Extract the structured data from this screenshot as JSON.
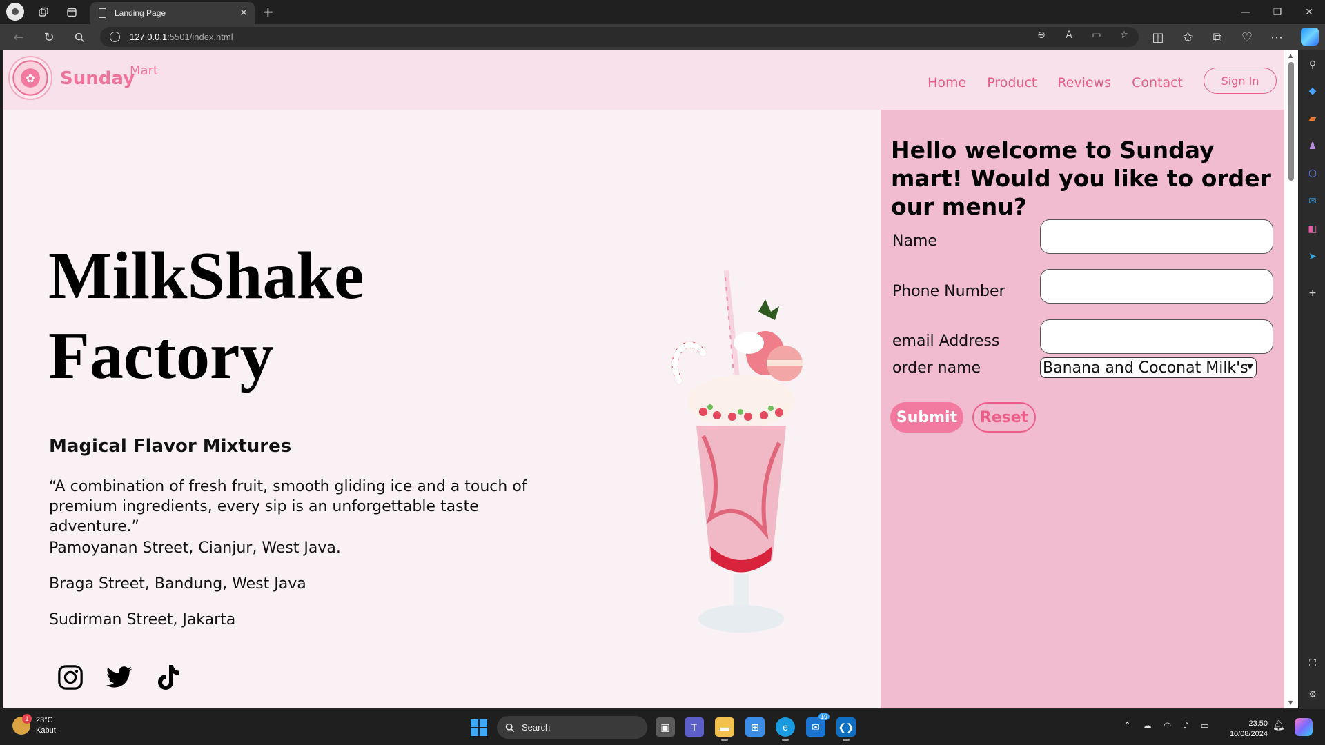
{
  "browser": {
    "tab_title": "Landing Page",
    "url_host": "127.0.0.1",
    "url_rest": ":5501/index.html"
  },
  "site": {
    "brand": "Sunday",
    "brand_sup": "Mart",
    "nav": [
      "Home",
      "Product",
      "Reviews",
      "Contact"
    ],
    "sign_in": "Sign In"
  },
  "hero": {
    "title_line1": "MilkShake",
    "title_line2": "Factory",
    "subheading": "Magical Flavor Mixtures",
    "quote": "“A combination of fresh fruit, smooth gliding ice and a touch of premium ingredients, every sip is an unforgettable taste adventure.”",
    "addresses": [
      "Pamoyanan Street, Cianjur, West Java.",
      "Braga Street, Bandung, West Java",
      "Sudirman Street, Jakarta"
    ],
    "socials": [
      "instagram-icon",
      "twitter-icon",
      "tiktok-icon"
    ]
  },
  "form": {
    "heading": "Hello welcome to Sunday mart! Would you like to order our menu?",
    "name_label": "Name",
    "phone_label": "Phone Number",
    "email_label": "email Address",
    "order_label": "order name",
    "order_selected": "Banana and Coconat Milk's",
    "submit": "Submit",
    "reset": "Reset"
  },
  "taskbar": {
    "temperature": "23°C",
    "weather": "Kabut",
    "weather_badge": "1",
    "search": "Search",
    "mail_badge": "19",
    "time": "23:50",
    "date": "10/08/2024"
  },
  "colors": {
    "accent": "#ec5e8a",
    "panel": "#f2bcd0",
    "header": "#f8e1ea",
    "page": "#f9f1f4"
  }
}
